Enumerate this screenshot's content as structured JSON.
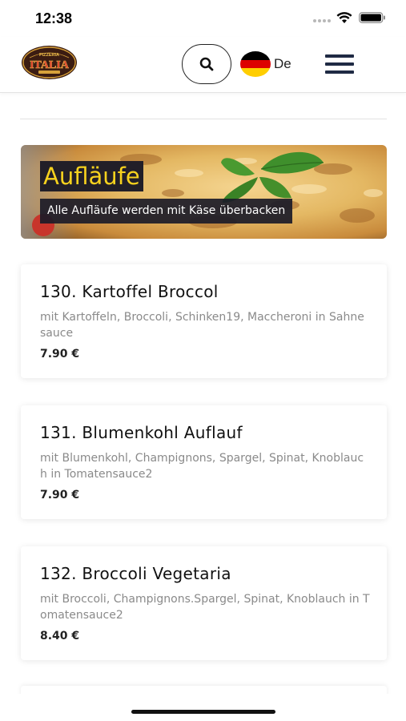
{
  "status_bar": {
    "time": "12:38"
  },
  "header": {
    "logo_text": "PIZZERIA ITALIA",
    "language": "De"
  },
  "category": {
    "title": "Aufläufe",
    "subtitle": "Alle Aufläufe werden mit Käse überbacken"
  },
  "products": [
    {
      "name": "130. Kartoffel Broccol",
      "description": "mit Kartoffeln, Broccoli, Schinken19, Maccheroni in Sahnesauce",
      "price": "7.90 €"
    },
    {
      "name": "131. Blumenkohl Auflauf",
      "description": "mit Blumenkohl, Champignons, Spargel, Spinat, Knoblauch in Tomatensauce2",
      "price": "7.90 €"
    },
    {
      "name": "132. Broccoli Vegetaria",
      "description": "mit Broccoli, Champignons.Spargel, Spinat, Knoblauch in Tomatensauce2",
      "price": "8.40 €"
    }
  ],
  "colors": {
    "accent_yellow": "#f7d21e",
    "menu_icon": "#1f2a44",
    "flag_black": "#000000",
    "flag_red": "#dd0000",
    "flag_gold": "#ffce00"
  },
  "icons": {
    "search": "search-icon",
    "menu": "hamburger-menu-icon",
    "wifi": "wifi-icon",
    "battery": "battery-icon",
    "flag": "germany-flag-icon"
  }
}
